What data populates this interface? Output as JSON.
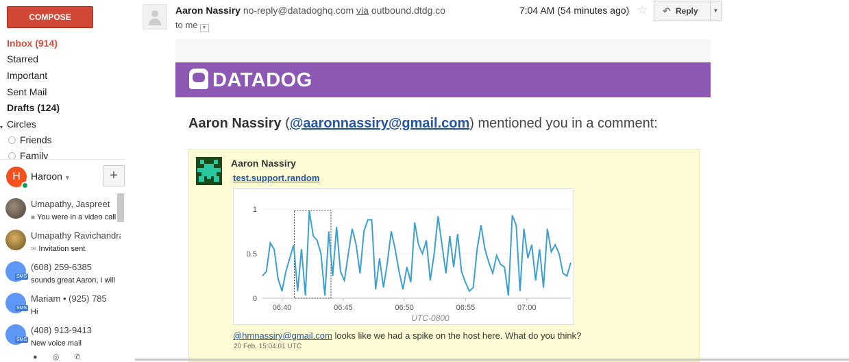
{
  "sidebar": {
    "compose_label": "COMPOSE",
    "nav": [
      {
        "label": "Inbox (914)"
      },
      {
        "label": "Starred"
      },
      {
        "label": "Important"
      },
      {
        "label": "Sent Mail"
      },
      {
        "label": "Drafts (124)"
      },
      {
        "label": "Circles"
      }
    ],
    "circles": [
      {
        "label": "Friends"
      },
      {
        "label": "Family"
      }
    ]
  },
  "hangouts": {
    "me_initial": "H",
    "me_name": "Haroon",
    "plus": "+",
    "contacts": [
      {
        "name": "Umapathy, Jaspreet",
        "sub": "You were in a video call",
        "sub_icon": "video-icon"
      },
      {
        "name": "Umapathy Ravichandran",
        "sub": "Invitation sent",
        "sub_icon": "mail-icon"
      },
      {
        "name": "(608) 259-6385",
        "sub": "sounds great Aaron, I will",
        "sub_icon": ""
      },
      {
        "name": "Mariam • (925) 785",
        "sub": "Hi",
        "sub_icon": ""
      },
      {
        "name": "(408) 913-9413",
        "sub": "New voice mail",
        "sub_icon": ""
      }
    ]
  },
  "message": {
    "sender_name": "Aaron Nassiry",
    "sender_email": "no-reply@datadoghq.com",
    "via_label": "via",
    "via_domain": "outbound.dtdg.co",
    "to": "to me",
    "time": "7:04 AM (54 minutes ago)",
    "reply_label": "Reply"
  },
  "email": {
    "logo_text": "DATADOG",
    "headline_name": "Aaron Nassiry",
    "headline_open": " (",
    "headline_email": "@aaronnassiry@gmail.com",
    "headline_rest": ") mentioned you in a comment:",
    "comment_author": "Aaron Nassiry",
    "comment_link": "test.support.random",
    "comment_mention": "@hmnassiry@gmail.com",
    "comment_text": " looks like we had a spike on the host here. What do you think?",
    "comment_timestamp": "20 Feb, 15:04:01 UTC"
  },
  "chart_data": {
    "type": "line",
    "x_ticks": [
      "06:40",
      "06:45",
      "06:50",
      "06:55",
      "07:00"
    ],
    "y_ticks": [
      "0",
      "0.5",
      "1"
    ],
    "xlabel": "UTC-0800",
    "ylim": [
      0,
      1
    ],
    "color": "#3d9fcf",
    "x_start_min": 38.4,
    "x_end_min": 63.6,
    "values": [
      0.25,
      0.3,
      0.62,
      0.55,
      0.22,
      0.08,
      0.3,
      0.45,
      0.6,
      0.08,
      0.55,
      0.03,
      0.98,
      0.7,
      0.65,
      0.5,
      0.03,
      0.75,
      0.25,
      0.8,
      0.3,
      0.2,
      0.5,
      0.78,
      0.6,
      0.28,
      0.75,
      0.88,
      0.88,
      0.1,
      0.45,
      0.12,
      0.4,
      0.75,
      0.55,
      0.3,
      0.1,
      0.35,
      0.18,
      0.85,
      0.6,
      0.5,
      0.65,
      0.2,
      0.5,
      0.92,
      0.6,
      0.28,
      0.7,
      0.35,
      0.72,
      0.3,
      0.18,
      0.08,
      0.12,
      0.55,
      0.82,
      0.55,
      0.4,
      0.28,
      0.48,
      0.38,
      0.35,
      0.03,
      0.93,
      0.82,
      0.08,
      0.78,
      0.45,
      0.6,
      0.2,
      0.55,
      0.12,
      0.78,
      0.52,
      0.6,
      0.5,
      0.28,
      0.25,
      0.4
    ],
    "highlight_range": [
      "06:41",
      "06:44"
    ]
  }
}
